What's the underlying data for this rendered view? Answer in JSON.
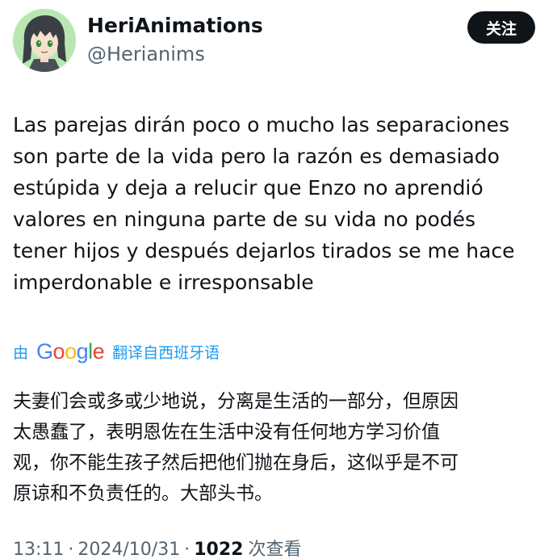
{
  "header": {
    "display_name": "HeriAnimations",
    "handle": "@Herianims",
    "follow_label": "关注"
  },
  "tweet": {
    "text": "Las parejas dirán poco o mucho las separaciones\nson parte de la vida pero la razón es demasiado\nestúpida y deja a relucir que Enzo no aprendió\nvalores en ninguna parte de su vida no podés\ntener hijos y después dejarlos tirados se me hace\nimperdonable e irresponsable"
  },
  "translation": {
    "prefix": "由",
    "provider_logo": {
      "letters": [
        "G",
        "o",
        "o",
        "g",
        "l",
        "e"
      ],
      "colors": [
        "#4285f4",
        "#ea4335",
        "#fbbc05",
        "#4285f4",
        "#34a853",
        "#ea4335"
      ]
    },
    "suffix": "翻译自西班牙语",
    "text": "夫妻们会或多或少地说，分离是生活的一部分，但原因\n太愚蠢了，表明恩佐在生活中没有任何地方学习价值\n观，你不能生孩子然后把他们抛在身后，这似乎是不可\n原谅和不负责任的。大部头书。"
  },
  "meta": {
    "time": "13:11",
    "separator": "·",
    "date": "2024/10/31",
    "views_count": "1022",
    "views_label": "次查看"
  },
  "colors": {
    "text_primary": "#0f1419",
    "text_secondary": "#536471",
    "link_blue": "#1d9bf0",
    "avatar_background": "#b9e7b2"
  }
}
